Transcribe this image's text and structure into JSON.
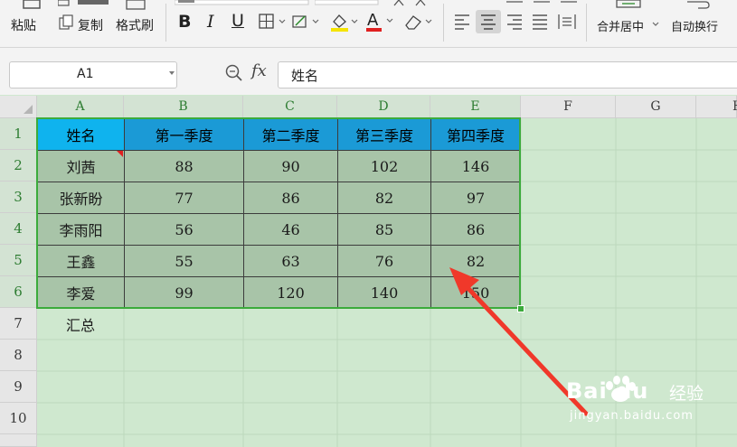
{
  "ribbon": {
    "paste": "粘贴",
    "copy": "复制",
    "format_painter": "格式刷",
    "bold": "B",
    "italic": "I",
    "underline": "U",
    "font_color_glyph": "A",
    "merge_center": "合并居中",
    "auto_wrap": "自动换行"
  },
  "formula_bar": {
    "name_box": "A1",
    "fx_label": "fx",
    "content": "姓名"
  },
  "columns": [
    "A",
    "B",
    "C",
    "D",
    "E",
    "F",
    "G",
    "H"
  ],
  "rows": [
    "1",
    "2",
    "3",
    "4",
    "5",
    "6",
    "7",
    "8",
    "9",
    "10"
  ],
  "table": {
    "headers": [
      "姓名",
      "第一季度",
      "第二季度",
      "第三季度",
      "第四季度"
    ],
    "rows": [
      [
        "刘茜",
        "88",
        "90",
        "102",
        "146"
      ],
      [
        "张新盼",
        "77",
        "86",
        "82",
        "97"
      ],
      [
        "李雨阳",
        "56",
        "46",
        "85",
        "86"
      ],
      [
        "王鑫",
        "55",
        "63",
        "76",
        "82"
      ],
      [
        "李爱",
        "99",
        "120",
        "140",
        "150"
      ]
    ],
    "summary_label": "汇总"
  },
  "watermark": {
    "brand": "Bai du",
    "brand_suffix": "经验",
    "url": "jingyan.baidu.com"
  },
  "colors": {
    "header_fill": "#1b9ad6",
    "header_first_fill": "#0fb3ee",
    "data_fill": "#a8c4a8",
    "selection_border": "#3cab3c",
    "sheet_bg": "#cfe8cf",
    "arrow": "#f0382a"
  }
}
